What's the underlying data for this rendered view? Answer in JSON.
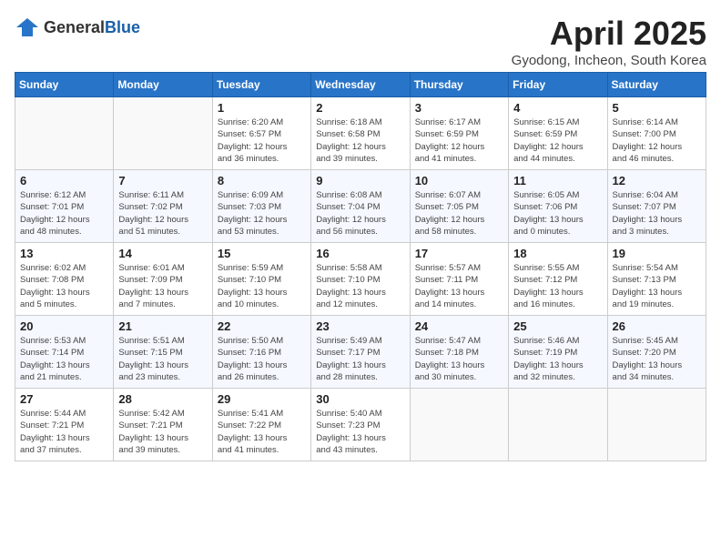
{
  "header": {
    "logo_general": "General",
    "logo_blue": "Blue",
    "month_title": "April 2025",
    "location": "Gyodong, Incheon, South Korea"
  },
  "days_of_week": [
    "Sunday",
    "Monday",
    "Tuesday",
    "Wednesday",
    "Thursday",
    "Friday",
    "Saturday"
  ],
  "weeks": [
    [
      {
        "day": "",
        "info": ""
      },
      {
        "day": "",
        "info": ""
      },
      {
        "day": "1",
        "info": "Sunrise: 6:20 AM\nSunset: 6:57 PM\nDaylight: 12 hours\nand 36 minutes."
      },
      {
        "day": "2",
        "info": "Sunrise: 6:18 AM\nSunset: 6:58 PM\nDaylight: 12 hours\nand 39 minutes."
      },
      {
        "day": "3",
        "info": "Sunrise: 6:17 AM\nSunset: 6:59 PM\nDaylight: 12 hours\nand 41 minutes."
      },
      {
        "day": "4",
        "info": "Sunrise: 6:15 AM\nSunset: 6:59 PM\nDaylight: 12 hours\nand 44 minutes."
      },
      {
        "day": "5",
        "info": "Sunrise: 6:14 AM\nSunset: 7:00 PM\nDaylight: 12 hours\nand 46 minutes."
      }
    ],
    [
      {
        "day": "6",
        "info": "Sunrise: 6:12 AM\nSunset: 7:01 PM\nDaylight: 12 hours\nand 48 minutes."
      },
      {
        "day": "7",
        "info": "Sunrise: 6:11 AM\nSunset: 7:02 PM\nDaylight: 12 hours\nand 51 minutes."
      },
      {
        "day": "8",
        "info": "Sunrise: 6:09 AM\nSunset: 7:03 PM\nDaylight: 12 hours\nand 53 minutes."
      },
      {
        "day": "9",
        "info": "Sunrise: 6:08 AM\nSunset: 7:04 PM\nDaylight: 12 hours\nand 56 minutes."
      },
      {
        "day": "10",
        "info": "Sunrise: 6:07 AM\nSunset: 7:05 PM\nDaylight: 12 hours\nand 58 minutes."
      },
      {
        "day": "11",
        "info": "Sunrise: 6:05 AM\nSunset: 7:06 PM\nDaylight: 13 hours\nand 0 minutes."
      },
      {
        "day": "12",
        "info": "Sunrise: 6:04 AM\nSunset: 7:07 PM\nDaylight: 13 hours\nand 3 minutes."
      }
    ],
    [
      {
        "day": "13",
        "info": "Sunrise: 6:02 AM\nSunset: 7:08 PM\nDaylight: 13 hours\nand 5 minutes."
      },
      {
        "day": "14",
        "info": "Sunrise: 6:01 AM\nSunset: 7:09 PM\nDaylight: 13 hours\nand 7 minutes."
      },
      {
        "day": "15",
        "info": "Sunrise: 5:59 AM\nSunset: 7:10 PM\nDaylight: 13 hours\nand 10 minutes."
      },
      {
        "day": "16",
        "info": "Sunrise: 5:58 AM\nSunset: 7:10 PM\nDaylight: 13 hours\nand 12 minutes."
      },
      {
        "day": "17",
        "info": "Sunrise: 5:57 AM\nSunset: 7:11 PM\nDaylight: 13 hours\nand 14 minutes."
      },
      {
        "day": "18",
        "info": "Sunrise: 5:55 AM\nSunset: 7:12 PM\nDaylight: 13 hours\nand 16 minutes."
      },
      {
        "day": "19",
        "info": "Sunrise: 5:54 AM\nSunset: 7:13 PM\nDaylight: 13 hours\nand 19 minutes."
      }
    ],
    [
      {
        "day": "20",
        "info": "Sunrise: 5:53 AM\nSunset: 7:14 PM\nDaylight: 13 hours\nand 21 minutes."
      },
      {
        "day": "21",
        "info": "Sunrise: 5:51 AM\nSunset: 7:15 PM\nDaylight: 13 hours\nand 23 minutes."
      },
      {
        "day": "22",
        "info": "Sunrise: 5:50 AM\nSunset: 7:16 PM\nDaylight: 13 hours\nand 26 minutes."
      },
      {
        "day": "23",
        "info": "Sunrise: 5:49 AM\nSunset: 7:17 PM\nDaylight: 13 hours\nand 28 minutes."
      },
      {
        "day": "24",
        "info": "Sunrise: 5:47 AM\nSunset: 7:18 PM\nDaylight: 13 hours\nand 30 minutes."
      },
      {
        "day": "25",
        "info": "Sunrise: 5:46 AM\nSunset: 7:19 PM\nDaylight: 13 hours\nand 32 minutes."
      },
      {
        "day": "26",
        "info": "Sunrise: 5:45 AM\nSunset: 7:20 PM\nDaylight: 13 hours\nand 34 minutes."
      }
    ],
    [
      {
        "day": "27",
        "info": "Sunrise: 5:44 AM\nSunset: 7:21 PM\nDaylight: 13 hours\nand 37 minutes."
      },
      {
        "day": "28",
        "info": "Sunrise: 5:42 AM\nSunset: 7:21 PM\nDaylight: 13 hours\nand 39 minutes."
      },
      {
        "day": "29",
        "info": "Sunrise: 5:41 AM\nSunset: 7:22 PM\nDaylight: 13 hours\nand 41 minutes."
      },
      {
        "day": "30",
        "info": "Sunrise: 5:40 AM\nSunset: 7:23 PM\nDaylight: 13 hours\nand 43 minutes."
      },
      {
        "day": "",
        "info": ""
      },
      {
        "day": "",
        "info": ""
      },
      {
        "day": "",
        "info": ""
      }
    ]
  ]
}
